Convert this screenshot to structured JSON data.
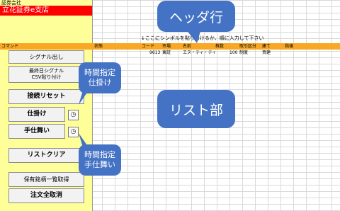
{
  "company_label": "証券会社",
  "branch_name": "立花証券e支店",
  "instruction": "↓ここにシンボルを貼り付けるか、順に入力して下さい",
  "header": {
    "command": "コマンド",
    "status": "状態",
    "code": "コード",
    "market": "市場",
    "name": "名前",
    "shares": "株数",
    "trade_type": "取引区分",
    "build": "建て",
    "direction": "指値"
  },
  "row": {
    "code": "9613",
    "market": "東証",
    "name": "エヌ・ティ・ティ",
    "shares": "100",
    "trade_type": "制度",
    "build": "買建"
  },
  "buttons": {
    "signal_out": "シグナル出し",
    "last_day_signal": "最終日シグナル\nCSV貼り付け",
    "reset_connection": "接続リセット",
    "order": "仕掛け",
    "exit": "手仕舞い",
    "list_clear": "リストクリア",
    "holdings": "保有銘柄一覧取得",
    "cancel_all": "注文全取消"
  },
  "callouts": {
    "header_row": "ヘッダ行",
    "list_area": "リスト部",
    "timed_order": "時間指定\n仕掛け",
    "timed_exit": "時間指定\n手仕舞い"
  },
  "icons": {
    "timer_order": "timer-icon",
    "timer_exit": "timer-icon"
  }
}
